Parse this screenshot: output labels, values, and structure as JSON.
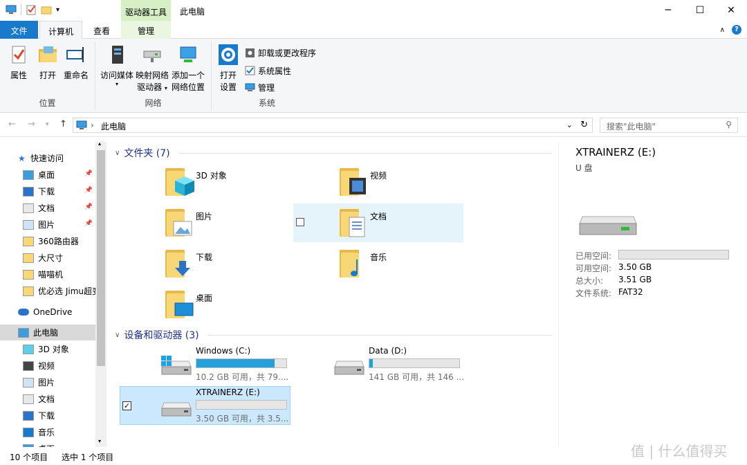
{
  "window": {
    "title": "此电脑",
    "context_tab_header": "驱动器工具",
    "minimize_icon": "minimize-icon",
    "maximize_icon": "maximize-icon",
    "close_icon": "close-icon"
  },
  "tabs": {
    "file": "文件",
    "computer": "计算机",
    "view": "查看",
    "manage": "管理"
  },
  "ribbon": {
    "location": {
      "label": "位置",
      "properties": "属性",
      "open": "打开",
      "rename": "重命名"
    },
    "network": {
      "label": "网络",
      "access_media": "访问媒体",
      "map_drive_1": "映射网络",
      "map_drive_2": "驱动器",
      "add_location_1": "添加一个",
      "add_location_2": "网络位置"
    },
    "system": {
      "label": "系统",
      "open_settings_1": "打开",
      "open_settings_2": "设置",
      "uninstall": "卸载或更改程序",
      "system_properties": "系统属性",
      "manage": "管理"
    }
  },
  "address": {
    "path": "此电脑",
    "search_placeholder": "搜索\"此电脑\""
  },
  "sidebar": {
    "quick_access": "快速访问",
    "items": [
      {
        "label": "桌面",
        "pinned": true
      },
      {
        "label": "下载",
        "pinned": true
      },
      {
        "label": "文档",
        "pinned": true
      },
      {
        "label": "图片",
        "pinned": true
      },
      {
        "label": "360路由器"
      },
      {
        "label": "大尺寸"
      },
      {
        "label": "喵喵机"
      },
      {
        "label": "优必选 Jimu超变"
      }
    ],
    "onedrive": "OneDrive",
    "this_pc": "此电脑",
    "pc_items": [
      "3D 对象",
      "视频",
      "图片",
      "文档",
      "下载",
      "音乐",
      "桌面"
    ]
  },
  "main": {
    "folders_header": "文件夹 (7)",
    "folders": [
      "3D 对象",
      "视频",
      "图片",
      "文档",
      "下载",
      "音乐",
      "桌面"
    ],
    "devices_header": "设备和驱动器 (3)",
    "drives": [
      {
        "name": "Windows (C:)",
        "info": "10.2 GB 可用，共 79....",
        "fill": 0.87
      },
      {
        "name": "Data (D:)",
        "info": "141 GB 可用，共 146 ...",
        "fill": 0.04
      },
      {
        "name": "XTRAINERZ (E:)",
        "info": "3.50 GB 可用，共 3.5...",
        "fill": 0.0
      }
    ]
  },
  "details": {
    "title": "XTRAINERZ (E:)",
    "subtitle": "U 盘",
    "used_label": "已用空间:",
    "free_label": "可用空间:",
    "free_value": "3.50 GB",
    "total_label": "总大小:",
    "total_value": "3.51 GB",
    "fs_label": "文件系统:",
    "fs_value": "FAT32"
  },
  "status": {
    "count": "10 个项目",
    "selected": "选中 1 个项目"
  },
  "watermark": "值 | 什么值得买",
  "colors": {
    "accent": "#1979ca",
    "selection": "#cce8ff",
    "drive_fill": "#26a0da",
    "folder": "#f8d776"
  }
}
